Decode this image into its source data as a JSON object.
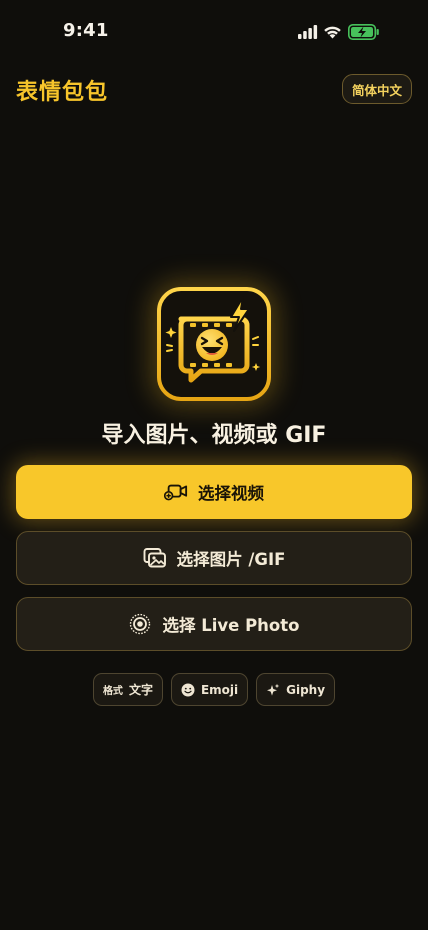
{
  "status_bar": {
    "time": "9:41",
    "icons": [
      "cellular-signal-icon",
      "wifi-icon",
      "battery-charging-icon"
    ]
  },
  "header": {
    "title": "表情包包",
    "language_button": "简体中文"
  },
  "hero": {
    "logo_icon": "laughing-film-logo-icon",
    "headline": "导入图片、视频或 GIF"
  },
  "actions": {
    "select_video": {
      "label": "选择视频",
      "icon": "video-add-icon"
    },
    "select_image": {
      "label": "选择图片 /GIF",
      "icon": "images-icon"
    },
    "select_live": {
      "label": "选择 Live Photo",
      "icon": "live-photo-icon"
    }
  },
  "chips": {
    "format": {
      "prefix": "格式",
      "label": "文字"
    },
    "emoji": {
      "label": "Emoji",
      "icon": "smiley-icon"
    },
    "giphy": {
      "label": "Giphy",
      "icon": "sparkle-icon"
    }
  },
  "colors": {
    "background": "#0f0e0b",
    "accent": "#f8c72a",
    "card": "#231f17",
    "border": "#5c4d29"
  }
}
